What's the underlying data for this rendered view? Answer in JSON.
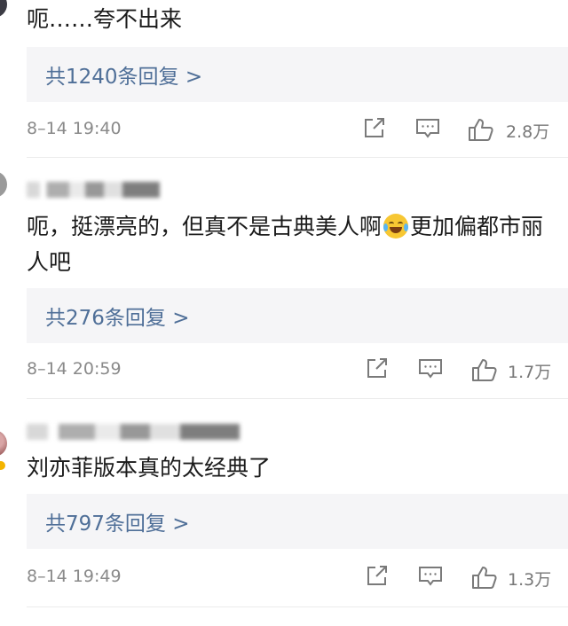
{
  "comments": [
    {
      "text": "呃……夸不出来",
      "replies_label": "共1240条回复 >",
      "time": "8–14 19:40",
      "likes": "2.8万"
    },
    {
      "text_before_emoji": "呃，挺漂亮的，但真不是古典美人啊",
      "emoji": "laugh-cry-emoji",
      "text_after_emoji": "更加偏都市丽人吧",
      "replies_label": "共276条回复 >",
      "time": "8–14 20:59",
      "likes": "1.7万"
    },
    {
      "text": "刘亦菲版本真的太经典了",
      "replies_label": "共797条回复 >",
      "time": "8–14 19:49",
      "likes": "1.3万"
    }
  ],
  "icons": {
    "share": "share-icon",
    "comment": "comment-icon",
    "like": "thumbs-up-icon"
  },
  "colors": {
    "reply_link": "#4f6f98",
    "reply_background": "#f5f5f7",
    "meta_text": "#8a8a8a"
  }
}
